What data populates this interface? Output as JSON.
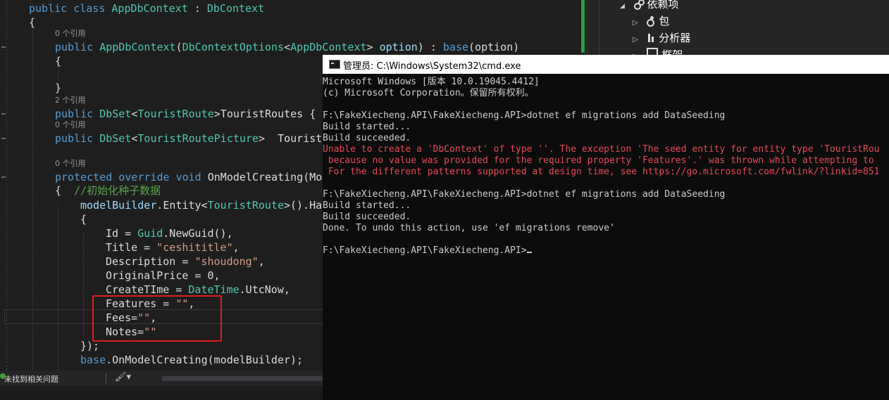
{
  "editor": {
    "code": {
      "l1": {
        "kw": "public class ",
        "name": "AppDbContext",
        "sep": " : ",
        "base": "DbContext"
      },
      "l2": "{",
      "ref1": "0 个引用",
      "l3": {
        "kw": "public ",
        "ctor": "AppDbContext",
        "p1": "(",
        "ptype": "DbContextOptions",
        "lt": "<",
        "gtype": "AppDbContext",
        "gt": ">",
        "pname": " option",
        "p2": ") : ",
        "base": "base",
        "p3": "(option)"
      },
      "l4": "{",
      "l5": "}",
      "ref2": "2 个引用",
      "l6": {
        "kw": "public ",
        "type": "DbSet",
        "lt": "<",
        "gtype": "TouristRoute",
        "gt": ">",
        "name": "TouristRoutes { "
      },
      "ref3": "0 个引用",
      "l7": {
        "kw": "public ",
        "type": "DbSet",
        "lt": "<",
        "gtype": "TouristRoutePicture",
        "gt": ">",
        "name": "  TouristR"
      },
      "ref4": "0 个引用",
      "l8": {
        "kw": "protected override void ",
        "name": "OnModelCreating(Mo"
      },
      "l9": {
        "brace": "{  ",
        "comment": "//初始化种子数据"
      },
      "l10": {
        "obj": "modelBuilder.",
        "method": "Entity",
        "lt": "<",
        "gtype": "TouristRoute",
        "gt": ">",
        "rest": "().Ha"
      },
      "l11": "{",
      "l12": {
        "name": "Id = ",
        "type": "Guid",
        "rest": ".NewGuid(),"
      },
      "l13": {
        "name": "Title = ",
        "str": "\"ceshititle\"",
        "rest": ","
      },
      "l14": {
        "name": "Description = ",
        "str": "\"shoudong\"",
        "rest": ","
      },
      "l15": "OriginalPrice = 0,",
      "l16": {
        "name": "CreateTIme = ",
        "type": "DateTime",
        "rest": ".UtcNow,"
      },
      "l17": {
        "name": "Features = ",
        "str": "\"\"",
        "rest": ","
      },
      "l18": {
        "name": "Fees=",
        "str": "\"\"",
        "rest": ","
      },
      "l19": {
        "name": "Notes=",
        "str": "\"\""
      },
      "l20": "});",
      "l21": {
        "kw": "base",
        "rest": ".OnModelCreating(modelBuilder);"
      }
    }
  },
  "statusbar": {
    "issues": "未找到相关问题",
    "brush_icon": "paintbrush-icon",
    "dropdown": "▾"
  },
  "solution_explorer": {
    "items": [
      {
        "label": "依赖项",
        "icon": "dependencies-icon",
        "arrow": "◢"
      },
      {
        "label": "包",
        "icon": "package-icon",
        "arrow": "▷"
      },
      {
        "label": "分析器",
        "icon": "analyzer-icon",
        "arrow": "▷"
      },
      {
        "label": "框架",
        "icon": "framework-icon",
        "arrow": "▷"
      }
    ]
  },
  "cmd": {
    "title": "管理员: C:\\Windows\\System32\\cmd.exe",
    "lines": [
      "Microsoft Windows [版本 10.0.19045.4412]",
      "(c) Microsoft Corporation。保留所有权利。",
      "",
      "F:\\FakeXiecheng.API\\FakeXiecheng.API>dotnet ef migrations add DataSeeding",
      "Build started...",
      "Build succeeded.",
      "Unable to create a 'DbContext' of type ''. The exception 'The seed entity for entity type 'TouristRou",
      " because no value was provided for the required property 'Features'.' was thrown while attempting to",
      " For the different patterns supported at design time, see https://go.microsoft.com/fwlink/?linkid=851",
      "",
      "F:\\FakeXiecheng.API\\FakeXiecheng.API>dotnet ef migrations add DataSeeding",
      "Build started...",
      "Build succeeded.",
      "Done. To undo this action, use 'ef migrations remove'",
      "",
      "F:\\FakeXiecheng.API\\FakeXiecheng.API>"
    ]
  },
  "colors": {
    "keyword": "#569cd6",
    "type": "#4ec9b0",
    "string": "#d69d85",
    "comment": "#57a64a",
    "error": "#e74856",
    "highlight_box": "#e0201e"
  }
}
